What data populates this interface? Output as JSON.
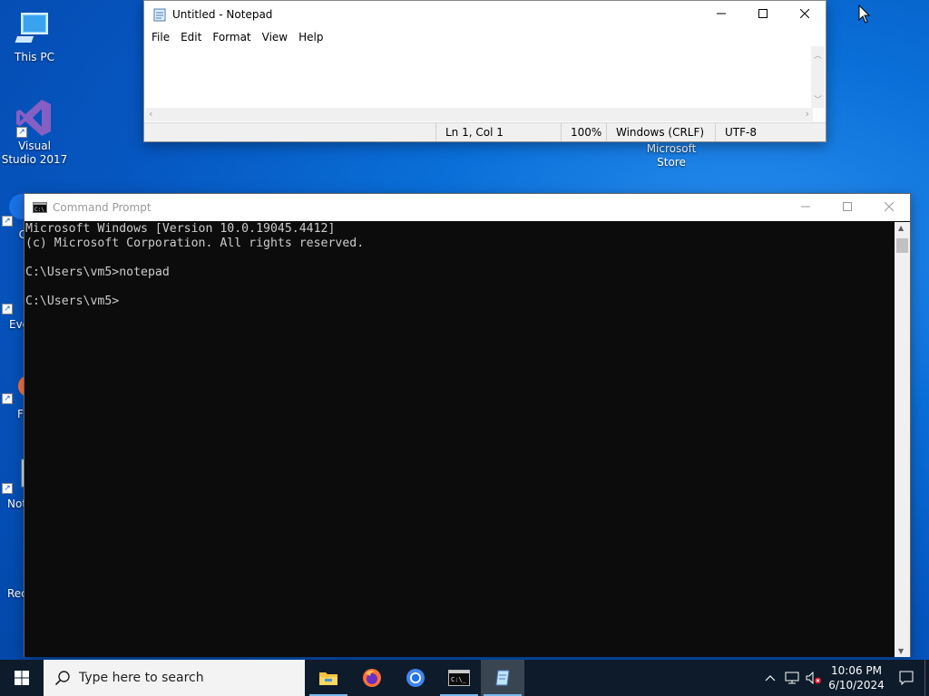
{
  "desktop": {
    "icons": [
      {
        "label": "This PC"
      },
      {
        "label": "Visual Studio 2017"
      },
      {
        "label": "Chi"
      },
      {
        "label": "Eve"
      },
      {
        "label": "F"
      },
      {
        "label": "Not"
      },
      {
        "label": "Rec"
      },
      {
        "label": "Microsoft Store"
      }
    ]
  },
  "notepad": {
    "title": "Untitled - Notepad",
    "menu": [
      "File",
      "Edit",
      "Format",
      "View",
      "Help"
    ],
    "content": "",
    "status": {
      "position": "Ln 1, Col 1",
      "zoom": "100%",
      "line_ending": "Windows (CRLF)",
      "encoding": "UTF-8"
    }
  },
  "cmd": {
    "title": "Command Prompt",
    "output": "Microsoft Windows [Version 10.0.19045.4412]\n(c) Microsoft Corporation. All rights reserved.\n\nC:\\Users\\vm5>notepad\n\nC:\\Users\\vm5>"
  },
  "taskbar": {
    "search_placeholder": "Type here to search",
    "time": "10:06 PM",
    "date": "6/10/2024"
  },
  "colors": {
    "accent": "#0078d7",
    "console_bg": "#0c0c0c",
    "console_fg": "#cccccc",
    "taskbar_bg": "#0d1b2a"
  }
}
